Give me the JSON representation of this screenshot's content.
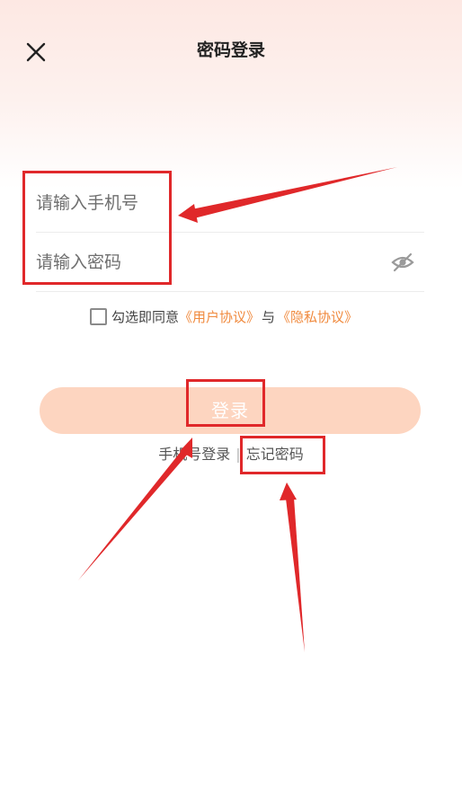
{
  "header": {
    "title": "密码登录",
    "close_icon": "close-icon"
  },
  "form": {
    "phone_placeholder": "请输入手机号",
    "password_placeholder": "请输入密码",
    "password_toggle_icon": "eye-off-icon"
  },
  "agreement": {
    "prefix": "勾选即同意",
    "user_agreement": "《用户协议》",
    "conjunction": "与",
    "privacy_policy": "《隐私协议》",
    "checked": false
  },
  "login_button": {
    "label": "登录"
  },
  "bottom_links": {
    "phone_login": "手机号登录",
    "separator": "|",
    "forgot_password": "忘记密码"
  },
  "colors": {
    "accent": "#f08a3e",
    "login_button_disabled": "#fdd5c0",
    "annotation": "#e0282a"
  }
}
